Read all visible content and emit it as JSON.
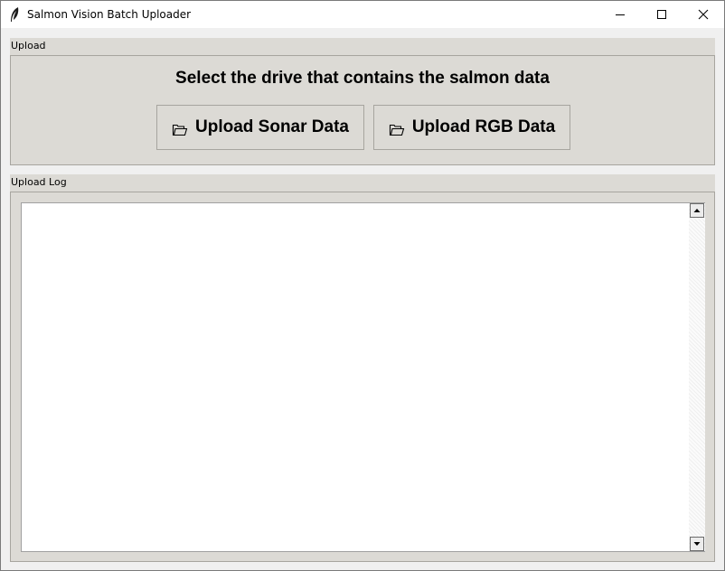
{
  "window": {
    "title": "Salmon Vision Batch Uploader",
    "app_icon": "feather-icon",
    "controls": [
      "minimize-icon",
      "maximize-icon",
      "close-icon"
    ]
  },
  "upload_section": {
    "label": "Upload",
    "prompt": "Select the drive that contains the salmon data",
    "buttons": [
      {
        "label": "Upload Sonar Data",
        "icon": "folder-icon"
      },
      {
        "label": "Upload RGB Data",
        "icon": "folder-icon"
      }
    ]
  },
  "log_section": {
    "label": "Upload Log",
    "content": "",
    "scrollbar_icons": [
      "scroll-up-arrow-icon",
      "scroll-down-arrow-icon"
    ]
  },
  "colors": {
    "panel_bg": "#dcdad5",
    "window_bg": "#f0f0f0",
    "log_bg": "#ffffff"
  }
}
